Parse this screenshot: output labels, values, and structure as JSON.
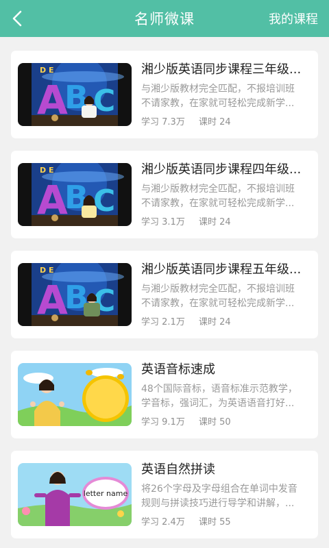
{
  "header": {
    "title": "名师微课",
    "right_link": "我的课程",
    "back_icon": "chevron-left-icon"
  },
  "courses": [
    {
      "title": "湘少版英语同步课程三年级...",
      "desc_line1": "与湘少版教材完全匹配，不报培训班",
      "desc_line2": "不请家教，在家就可轻松完成新学...",
      "learn_label": "学习",
      "learn_count": "7.3万",
      "lessons_label": "课时",
      "lessons_count": "24",
      "thumb": "abc-studio"
    },
    {
      "title": "湘少版英语同步课程四年级...",
      "desc_line1": "与湘少版教材完全匹配，不报培训班",
      "desc_line2": "不请家教，在家就可轻松完成新学...",
      "learn_label": "学习",
      "learn_count": "3.1万",
      "lessons_label": "课时",
      "lessons_count": "24",
      "thumb": "abc-studio"
    },
    {
      "title": "湘少版英语同步课程五年级...",
      "desc_line1": "与湘少版教材完全匹配，不报培训班",
      "desc_line2": "不请家教，在家就可轻松完成新学...",
      "learn_label": "学习",
      "learn_count": "2.1万",
      "lessons_label": "课时",
      "lessons_count": "24",
      "thumb": "abc-studio"
    },
    {
      "title": "英语音标速成",
      "desc_line1": "48个国际音标，语音标准示范教学，",
      "desc_line2": "学音标，强词汇，为英语语音打好...",
      "learn_label": "学习",
      "learn_count": "9.1万",
      "lessons_label": "课时",
      "lessons_count": "50",
      "thumb": "phonics-cartoon"
    },
    {
      "title": "英语自然拼读",
      "desc_line1": "将26个字母及字母组合在单词中发音",
      "desc_line2": "规则与拼读技巧进行导学和讲解，...",
      "learn_label": "学习",
      "learn_count": "2.4万",
      "lessons_label": "课时",
      "lessons_count": "55",
      "thumb": "letter-name-board",
      "thumb_caption": "letter name"
    }
  ],
  "colors": {
    "header_bg": "#52bfa5",
    "page_bg": "#f1f1f1",
    "card_bg": "#ffffff"
  }
}
